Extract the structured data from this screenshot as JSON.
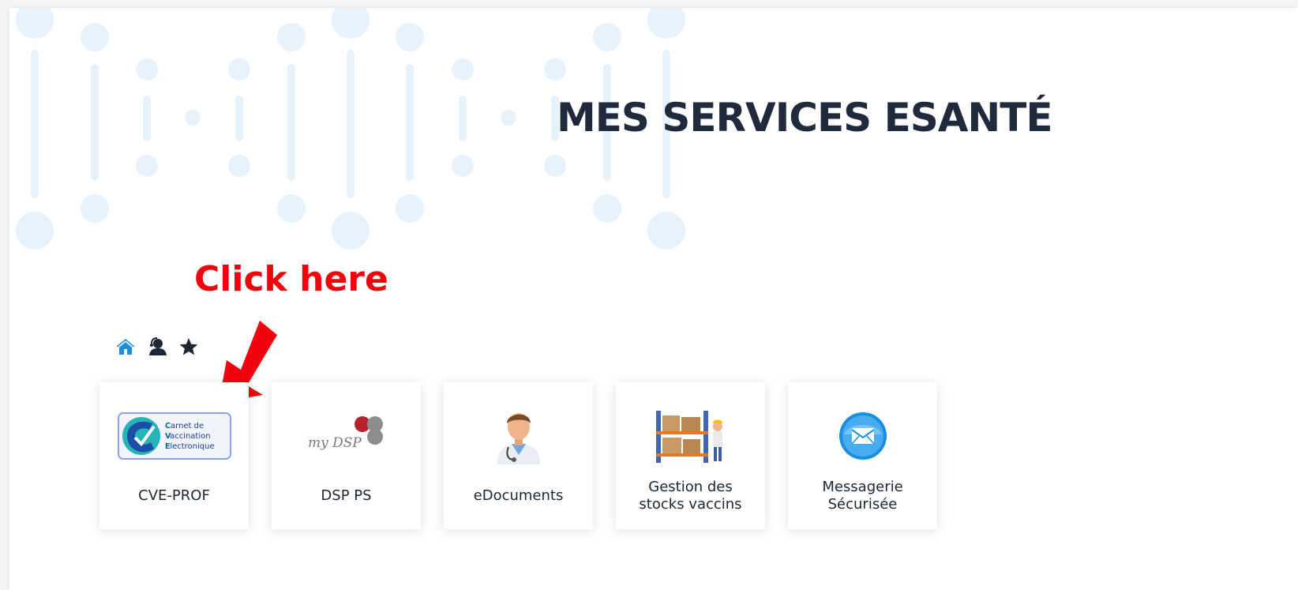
{
  "header": {
    "title": "MES SERVICES ESANTÉ"
  },
  "annotation": {
    "text": "Click here"
  },
  "toolbar": {
    "icons": [
      "home-icon",
      "user-support-icon",
      "star-icon"
    ]
  },
  "services": [
    {
      "label": "CVE-PROF",
      "icon": "carnet-vaccination-logo",
      "logo_lines": [
        "Carnet de",
        "Vaccination",
        "Electronique"
      ]
    },
    {
      "label": "DSP PS",
      "icon": "mydsp-logo",
      "logo_text": "my DSP"
    },
    {
      "label": "eDocuments",
      "icon": "doctor-icon"
    },
    {
      "label": "Gestion des\nstocks vaccins",
      "icon": "warehouse-icon"
    },
    {
      "label": "Messagerie\nSécurisée",
      "icon": "secure-mail-icon"
    }
  ],
  "colors": {
    "title": "#1f2a3c",
    "annotation": "#f2020c",
    "accent": "#1a8fe0",
    "deco": "#e6f3fd"
  }
}
